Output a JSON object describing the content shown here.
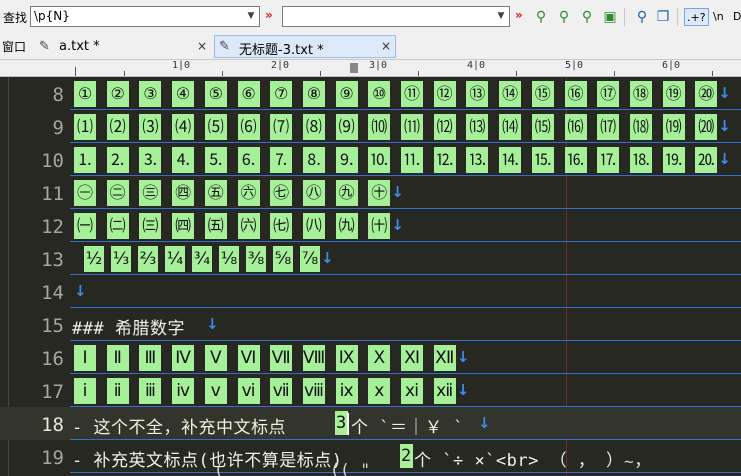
{
  "toolbar": {
    "find_label": "查找",
    "search_value": "\\p{N}",
    "replace_value": "",
    "regex_toggle": ".+?",
    "newline_toggle": "\\n",
    "icons": [
      "find-next-icon",
      "find-prev-icon",
      "find-all-icon",
      "mark-all-icon",
      "find-in-files-icon",
      "copy-icon"
    ]
  },
  "tabs": {
    "window_label": "窗口",
    "items": [
      {
        "label": "a.txt *",
        "close": "×"
      },
      {
        "label": "无标题-3.txt *",
        "close": "×"
      }
    ]
  },
  "ruler": {
    "marks": [
      "|",
      "1|0",
      "|",
      "2|0",
      "|",
      "3|0",
      "|",
      "4|0",
      "|",
      "5|0",
      "|",
      "6|0"
    ]
  },
  "editor": {
    "eol_glyph": "↓",
    "lines": [
      {
        "num": "8",
        "cells": [
          "①",
          "②",
          "③",
          "④",
          "⑤",
          "⑥",
          "⑦",
          "⑧",
          "⑨",
          "⑩",
          "⑪",
          "⑫",
          "⑬",
          "⑭",
          "⑮",
          "⑯",
          "⑰",
          "⑱",
          "⑲",
          "⑳"
        ]
      },
      {
        "num": "9",
        "cells": [
          "⑴",
          "⑵",
          "⑶",
          "⑷",
          "⑸",
          "⑹",
          "⑺",
          "⑻",
          "⑼",
          "⑽",
          "⑾",
          "⑿",
          "⒀",
          "⒁",
          "⒂",
          "⒃",
          "⒄",
          "⒅",
          "⒆",
          "⒇"
        ]
      },
      {
        "num": "10",
        "cells": [
          "⒈",
          "⒉",
          "⒊",
          "⒋",
          "⒌",
          "⒍",
          "⒎",
          "⒏",
          "⒐",
          "⒑",
          "⒒",
          "⒓",
          "⒔",
          "⒕",
          "⒖",
          "⒗",
          "⒘",
          "⒙",
          "⒚",
          "⒛"
        ]
      },
      {
        "num": "11",
        "cells": [
          "㊀",
          "㊁",
          "㊂",
          "㊃",
          "㊄",
          "㊅",
          "㊆",
          "㊇",
          "㊈",
          "㊉"
        ]
      },
      {
        "num": "12",
        "cells": [
          "㈠",
          "㈡",
          "㈢",
          "㈣",
          "㈤",
          "㈥",
          "㈦",
          "㈧",
          "㈨",
          "㈩"
        ]
      },
      {
        "num": "13",
        "cells": [
          "½",
          "⅓",
          "⅔",
          "¼",
          "¾",
          "⅛",
          "⅜",
          "⅝",
          "⅞"
        ]
      },
      {
        "num": "14",
        "cells": []
      },
      {
        "num": "15",
        "text": "### 希腊数字"
      },
      {
        "num": "16",
        "cells": [
          "Ⅰ",
          "Ⅱ",
          "Ⅲ",
          "Ⅳ",
          "Ⅴ",
          "Ⅵ",
          "Ⅶ",
          "Ⅷ",
          "Ⅸ",
          "Ⅹ",
          "Ⅺ",
          "Ⅻ"
        ]
      },
      {
        "num": "17",
        "cells": [
          "ⅰ",
          "ⅱ",
          "ⅲ",
          "ⅳ",
          "ⅴ",
          "ⅵ",
          "ⅶ",
          "ⅷ",
          "ⅸ",
          "ⅹ",
          "ⅺ",
          "ⅻ"
        ]
      },
      {
        "num": "18",
        "text_before": "- 这个不全，补充中文标点",
        "match": "3",
        "text_after": "个 `＝｜￥ `"
      },
      {
        "num": "19",
        "text_before": "- 补充英文标点(也许不算是标点)",
        "match": "2",
        "text_after": "个 `÷ ×`<br> （ ， ） ，"
      }
    ]
  },
  "colors": {
    "background": "#272822",
    "match_highlight": "#a6f09a",
    "eol_marker": "#3a8ee6",
    "line_number": "#a6a69a"
  }
}
